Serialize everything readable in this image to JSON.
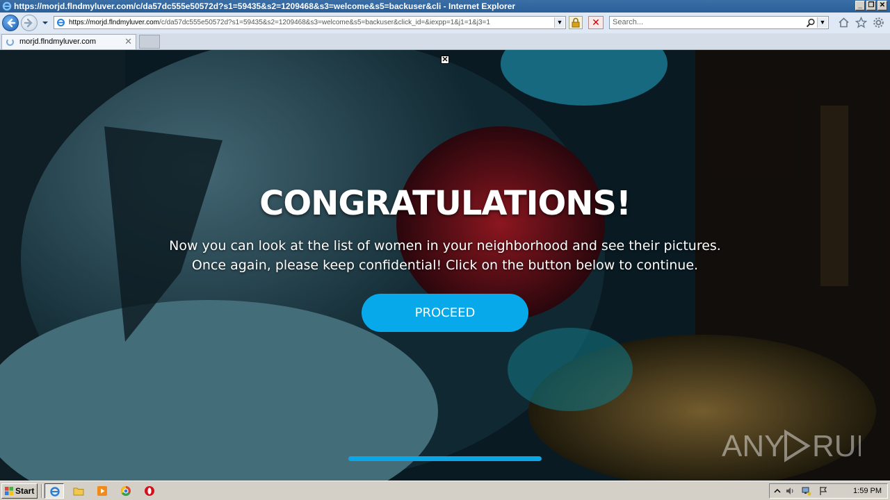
{
  "window": {
    "title": "https://morjd.flndmyluver.com/c/da57dc555e50572d?s1=59435&s2=1209468&s3=welcome&s5=backuser&cli - Internet Explorer"
  },
  "address_bar": {
    "url_host": "https://morjd.flndmyluver.com",
    "url_rest": "/c/da57dc555e50572d?s1=59435&s2=1209468&s3=welcome&s5=backuser&click_id=&iexpp=1&j1=1&j3=1"
  },
  "search": {
    "placeholder": "Search..."
  },
  "tabs": [
    {
      "label": "morjd.flndmyluver.com"
    }
  ],
  "page": {
    "headline": "CONGRATULATIONS!",
    "message": "Now you can look at the list of women in your neighborhood and see their pictures. Once again, please keep confidential! Click on the button below to continue.",
    "button_label": "PROCEED",
    "progress": 1.0,
    "watermark": "ANY RUN"
  },
  "taskbar": {
    "start_label": "Start",
    "clock": "1:59 PM"
  },
  "colors": {
    "button": "#08a9ea",
    "progress": "#0aa6e8",
    "titlebar": "#2b5f9a"
  }
}
